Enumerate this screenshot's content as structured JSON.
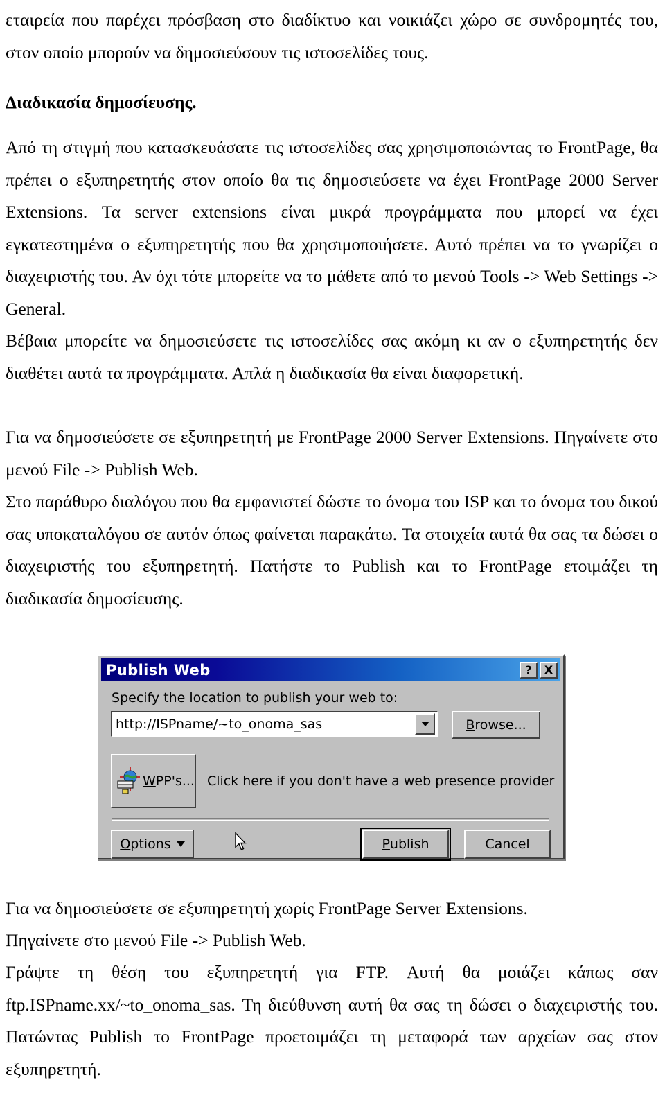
{
  "document": {
    "paragraphs": [
      {
        "id": "p-intro",
        "style": "normal",
        "text": "εταιρεία που παρέχει πρόσβαση στο διαδίκτυο και νοικιάζει χώρο σε συνδρομητές του, στον οποίο μπορούν να δημοσιεύσουν τις ιστοσελίδες τους."
      }
    ],
    "heading": "Διαδικασία δημοσίευσης.",
    "para_extensions": "Από τη στιγμή που κατασκευάσατε τις ιστοσελίδες σας χρησιμοποιώντας το FrontPage, θα πρέπει ο εξυπηρετητής στον οποίο θα τις δημοσιεύσετε να έχει FrontPage 2000 Server Extensions. Τα server extensions είναι μικρά προγράμματα που μπορεί να έχει εγκατεστημένα ο εξυπηρετητής που θα χρησιμοποιήσετε. Αυτό πρέπει να το γνωρίζει ο διαχειριστής του. Αν όχι τότε μπορείτε να το μάθετε από το μενού Tools -> Web Settings -> General.",
    "para_without": "Βέβαια μπορείτε να δημοσιεύσετε τις ιστοσελίδες σας ακόμη κι αν ο εξυπηρετητής δεν διαθέτει αυτά τα προγράμματα. Απλά η διαδικασία θα είναι διαφορετική.",
    "para_with_ext_1": "Για να δημοσιεύσετε σε εξυπηρετητή με FrontPage 2000 Server Extensions. Πηγαίνετε στο μενού File -> Publish Web.",
    "para_with_ext_2": "Στο παράθυρο διαλόγου που θα εμφανιστεί δώστε το όνομα του ISP και το όνομα του δικού σας υποκαταλόγου σε αυτόν όπως φαίνεται παρακάτω. Τα στοιχεία αυτά θα σας τα δώσει ο διαχειριστής του εξυπηρετητή. Πατήστε το Publish και το FrontPage ετοιμάζει τη διαδικασία δημοσίευσης.",
    "para_no_ext_1": "Για να δημοσιεύσετε σε εξυπηρετητή χωρίς FrontPage Server Extensions.",
    "para_no_ext_2": "Πηγαίνετε στο μενού File -> Publish Web.",
    "para_no_ext_3": "Γράψτε τη θέση του εξυπηρετητή για FTP. Αυτή θα μοιάζει κάπως σαν ftp.ISPname.xx/~to_onoma_sas. Τη διεύθυνση αυτή θα σας τη δώσει ο διαχειριστής του. Πατώντας Publish το FrontPage προετοιμάζει τη μεταφορά των αρχείων σας στον εξυπηρετητή."
  },
  "dialog": {
    "title": "Publish Web",
    "help_button": "?",
    "close_button": "X",
    "location_label": "Specify the location to publish your web to:",
    "location_label_accesskey": "S",
    "location_value": "http://ISPname/~to_onoma_sas",
    "browse_button": "Browse...",
    "browse_accesskey": "B",
    "wpp_button": "WPP's...",
    "wpp_accesskey": "W",
    "wpp_hint": "Click here if you don't have a web presence provider",
    "options_button": "Options",
    "options_accesskey": "O",
    "publish_button": "Publish",
    "publish_accesskey": "P",
    "cancel_button": "Cancel",
    "colors": {
      "face": "#c0c0c0",
      "title_start": "#00007b",
      "title_end": "#4aa3e8",
      "field_bg": "#ffffff",
      "text": "#000000"
    }
  }
}
